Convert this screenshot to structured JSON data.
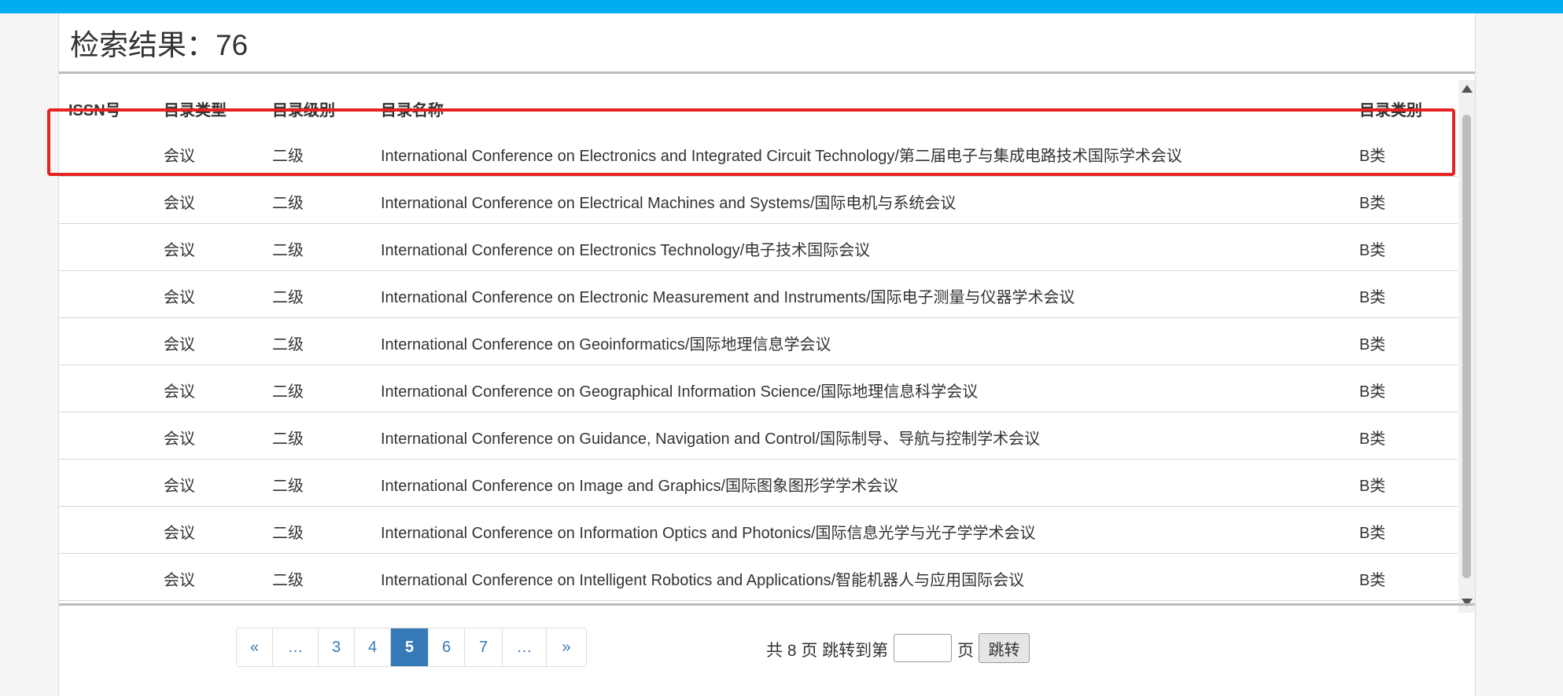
{
  "header": {
    "title": "检索结果：76"
  },
  "table": {
    "columns": [
      "ISSN号",
      "目录类型",
      "目录级别",
      "目录名称",
      "目录类别"
    ],
    "rows": [
      {
        "issn": "",
        "type": "会议",
        "level": "二级",
        "name": "International Conference on Electronics and Integrated Circuit Technology/第二届电子与集成电路技术国际学术会议",
        "category": "B类"
      },
      {
        "issn": "",
        "type": "会议",
        "level": "二级",
        "name": "International Conference on Electrical Machines and Systems/国际电机与系统会议",
        "category": "B类"
      },
      {
        "issn": "",
        "type": "会议",
        "level": "二级",
        "name": "International Conference on Electronics Technology/电子技术国际会议",
        "category": "B类"
      },
      {
        "issn": "",
        "type": "会议",
        "level": "二级",
        "name": "International Conference on Electronic Measurement and Instruments/国际电子测量与仪器学术会议",
        "category": "B类"
      },
      {
        "issn": "",
        "type": "会议",
        "level": "二级",
        "name": "International Conference on Geoinformatics/国际地理信息学会议",
        "category": "B类"
      },
      {
        "issn": "",
        "type": "会议",
        "level": "二级",
        "name": "International Conference on Geographical Information Science/国际地理信息科学会议",
        "category": "B类"
      },
      {
        "issn": "",
        "type": "会议",
        "level": "二级",
        "name": "International Conference on Guidance, Navigation and Control/国际制导、导航与控制学术会议",
        "category": "B类"
      },
      {
        "issn": "",
        "type": "会议",
        "level": "二级",
        "name": "International Conference on Image and Graphics/国际图象图形学学术会议",
        "category": "B类"
      },
      {
        "issn": "",
        "type": "会议",
        "level": "二级",
        "name": "International Conference on Information Optics and Photonics/国际信息光学与光子学学术会议",
        "category": "B类"
      },
      {
        "issn": "",
        "type": "会议",
        "level": "二级",
        "name": "International Conference on Intelligent Robotics and Applications/智能机器人与应用国际会议",
        "category": "B类"
      }
    ]
  },
  "pagination": {
    "items": [
      "«",
      "…",
      "3",
      "4",
      "5",
      "6",
      "7",
      "…",
      "»"
    ],
    "active": "5",
    "info": "共 8 页 跳转到第",
    "page_suffix": "页",
    "jump_input_value": "",
    "jump_label": "跳转"
  },
  "colors": {
    "topbar": "#00aeef",
    "highlight": "#e62323",
    "link": "#337ab7"
  }
}
